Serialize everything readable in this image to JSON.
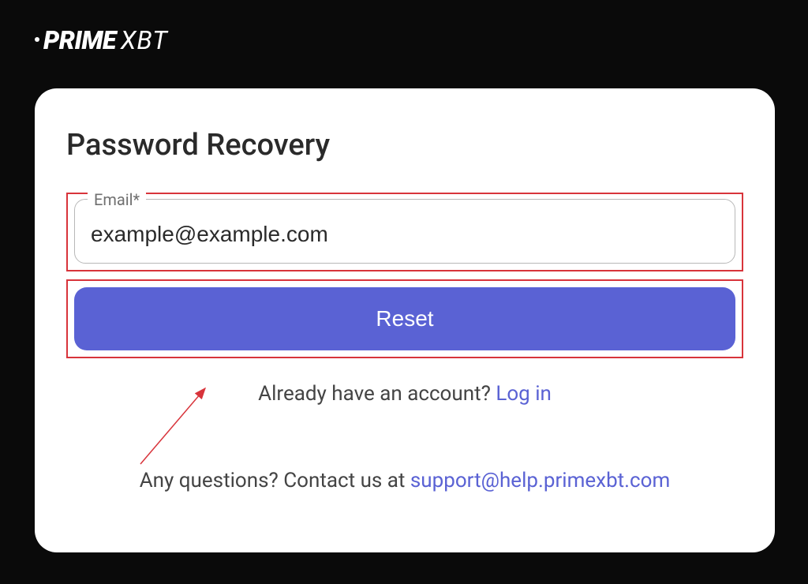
{
  "brand": {
    "name_part1": "PRIME",
    "name_part2": "XBT"
  },
  "card": {
    "title": "Password Recovery",
    "email": {
      "label": "Email*",
      "value": "example@example.com"
    },
    "reset_button": "Reset",
    "account_prompt": "Already have an account? ",
    "login_link": "Log in",
    "contact_prompt": "Any questions? Contact us at ",
    "support_email": "support@help.primexbt.com"
  }
}
